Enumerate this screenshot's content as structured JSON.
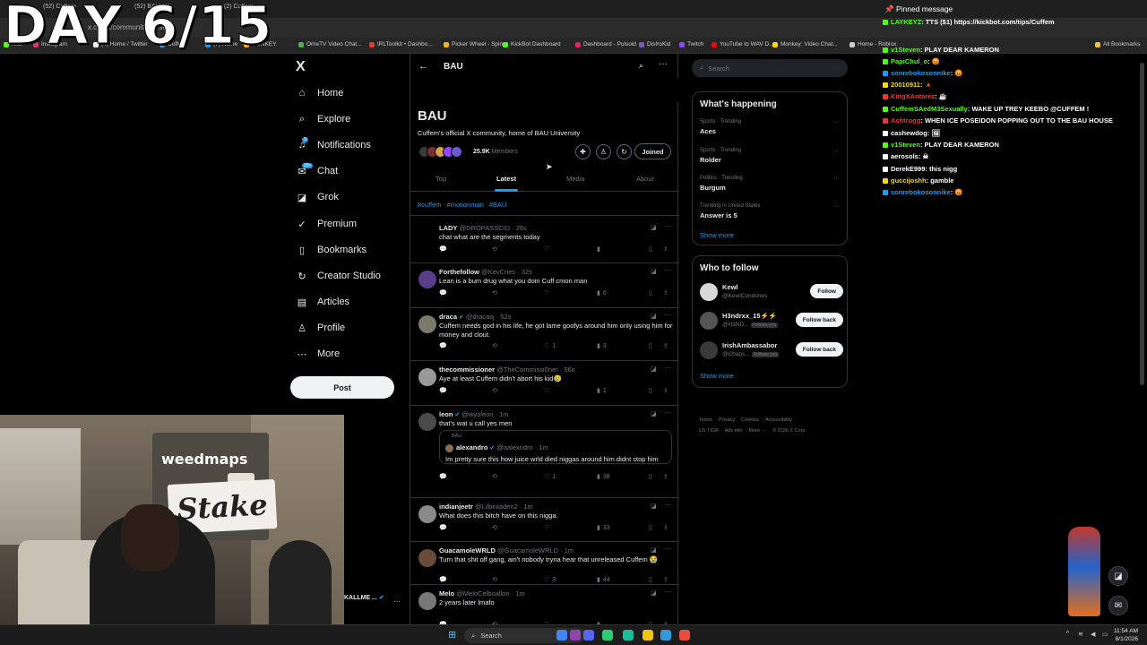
{
  "overlay": {
    "day_text": "DAY 6/15"
  },
  "browser": {
    "tabs": [
      "(52) Cuffem",
      "(52) BAU / X",
      "(2) Cuffem"
    ],
    "url": "x.com/i/communities/19086",
    "bookmarks": [
      "Kick",
      "Instagram",
      "(4) Home / Twitter",
      "Cuffem",
      "(7) Home",
      "DONKEY",
      "OmeTV Video Chat...",
      "IRLToolkit • Dashbo...",
      "Picker Wheel - Spin...",
      "KickBot Dashboard",
      "Dashboard - Pulsoid",
      "DistroKid",
      "Twitch",
      "YouTube to WAV D...",
      "Monkey: Video Chat...",
      "Home - Roblox",
      "All Bookmarks"
    ],
    "bookmark_colors": [
      "#53fc18",
      "#e1306c",
      "#ffffff",
      "#1d9bf0",
      "#1d9bf0",
      "#f5a623",
      "#4caf50",
      "#e53935",
      "#ffb300",
      "#53fc18",
      "#e91e63",
      "#7e57c2",
      "#9146ff",
      "#ff0000",
      "#ffd600",
      "#cccccc",
      "#f0c040"
    ]
  },
  "nav": {
    "logo": "X",
    "items": [
      {
        "label": "Home",
        "icon": "⌂"
      },
      {
        "label": "Explore",
        "icon": "⌕"
      },
      {
        "label": "Notifications",
        "icon": "♫",
        "badge": "3"
      },
      {
        "label": "Chat",
        "icon": "✉",
        "badge": "20+"
      },
      {
        "label": "Grok",
        "icon": "◪"
      },
      {
        "label": "Premium",
        "icon": "✓"
      },
      {
        "label": "Bookmarks",
        "icon": "▯"
      },
      {
        "label": "Creator Studio",
        "icon": "↻"
      },
      {
        "label": "Articles",
        "icon": "▤"
      },
      {
        "label": "Profile",
        "icon": "♙"
      },
      {
        "label": "More",
        "icon": "⋯"
      }
    ],
    "post_label": "Post"
  },
  "community": {
    "header_title": "BAU",
    "name": "BAU",
    "description": "Cuffem's official X community, home of BAU University",
    "member_count": "25.9K",
    "members_label": "Members",
    "joined_label": "Joined",
    "avatar_colors": [
      "#3a3a3a",
      "#7a2e2e",
      "#d4a04a",
      "#9146ff",
      "#6a5acd"
    ],
    "tabs": [
      {
        "label": "Top",
        "active": false
      },
      {
        "label": "Latest",
        "active": true
      },
      {
        "label": "Media",
        "active": false
      },
      {
        "label": "About",
        "active": false
      }
    ],
    "hashtags": [
      "#cuffem",
      "#motionman",
      "#BAU"
    ]
  },
  "tweets": [
    {
      "name": "LADY",
      "handle": "@DROPASSCID",
      "time": "26s",
      "verified": false,
      "text": "chat what are the segments today",
      "replies": "",
      "reposts": "",
      "likes": "",
      "views": "",
      "avatar": "#000000"
    },
    {
      "name": "Forthefollow",
      "handle": "@KevCries",
      "time": "32s",
      "verified": false,
      "text": "Lean is a bum drug what you doin Cuff cmon man",
      "replies": "",
      "reposts": "",
      "likes": "",
      "views": "6",
      "avatar": "#5a3e8a"
    },
    {
      "name": "draca",
      "handle": "@dracasj",
      "time": "52s",
      "verified": true,
      "text": "Cuffem needs god in his life, he got lame goofys around him only using him for money and clout.",
      "replies": "",
      "reposts": "",
      "likes": "1",
      "views": "3",
      "avatar": "#7a7a6a"
    },
    {
      "name": "thecommissioner",
      "handle": "@TheCommissi0ner",
      "time": "56s",
      "verified": false,
      "text": "Aye at least Cuffem didn't abort his kid😢",
      "replies": "",
      "reposts": "",
      "likes": "",
      "views": "1",
      "avatar": "#999999"
    },
    {
      "name": "leon",
      "handle": "@wyoleon",
      "time": "1m",
      "verified": true,
      "text": "that's wat u call yes men",
      "replies": "",
      "reposts": "",
      "likes": "1",
      "views": "38",
      "avatar": "#4a4a4a",
      "quote": {
        "community": "BAU",
        "name": "alexandro",
        "handle": "@aalexndro",
        "time": "1m",
        "verified": true,
        "text": "Im pretty sure this how juice wrld died niggas around him didnt stop him"
      }
    },
    {
      "name": "indianjeetr",
      "handle": "@Lilbinladen2",
      "time": "1m",
      "verified": false,
      "text": "What does this bitch have on this nigga.",
      "replies": "",
      "reposts": "",
      "likes": "",
      "views": "33",
      "avatar": "#8a8a8a"
    },
    {
      "name": "GuacamoleWRLD",
      "handle": "@GuacamoleWRLD",
      "time": "1m",
      "verified": false,
      "text": "Turn that shit off gang, ain't nobody tryna hear that unreleased Cuffem 😭",
      "replies": "",
      "reposts": "",
      "likes": "3",
      "views": "44",
      "avatar": "#6a4a3a"
    },
    {
      "name": "Melo",
      "handle": "@MeloCelboallon",
      "time": "1m",
      "verified": false,
      "text": "2 years later lmafo",
      "replies": "",
      "reposts": "",
      "likes": "",
      "views": "",
      "avatar": "#777777"
    }
  ],
  "right": {
    "search_placeholder": "Search",
    "happening_title": "What's happening",
    "trends": [
      {
        "meta": "Sports · Trending",
        "name": "Aces"
      },
      {
        "meta": "Sports · Trending",
        "name": "Rolder"
      },
      {
        "meta": "Politics · Trending",
        "name": "Burgum"
      },
      {
        "meta": "Trending in United States",
        "name": "Answer is 5"
      }
    ],
    "show_more": "Show more",
    "who_title": "Who to follow",
    "who": [
      {
        "name": "Kewl",
        "handle": "@KewlCondones",
        "button": "Follow",
        "follows_you": false
      },
      {
        "name": "H3ndrxx_15⚡⚡",
        "handle": "@H3ND...",
        "button": "Follow back",
        "follows_you": true
      },
      {
        "name": "IrishAmbassabor",
        "handle": "@Chaps...",
        "button": "Follow back",
        "follows_you": true
      }
    ],
    "follows_you_label": "Follows you",
    "footer": [
      "Terms",
      "Privacy",
      "Cookies",
      "Accessibility",
      "US TIDA",
      "Ads info",
      "More ···",
      "© 2026 X Corp."
    ]
  },
  "chat": {
    "pinned": "Pinned message",
    "messages": [
      {
        "user": "LAYKEYZ",
        "color": "#53fc18",
        "text": "TTS ($1) https://kickbot.com/tips/Cuffem"
      },
      {
        "user": "v1Steven",
        "color": "#53fc18",
        "text": "PLAY DEAR KAMERON"
      },
      {
        "user": "PapiChul_o",
        "color": "#53fc18",
        "text": "😡"
      },
      {
        "user": "sonrebokosonnike",
        "color": "#1d9bf0",
        "text": "😡"
      },
      {
        "user": "20010911",
        "color": "#f5d90a",
        "text": "🔺"
      },
      {
        "user": "KingXAntarez",
        "color": "#e53935",
        "text": "☕"
      },
      {
        "user": "CuffemSAedM3Sexually",
        "color": "#53fc18",
        "text": "WAKE UP TREY KEEBO @CUFFEM !"
      },
      {
        "user": "Ashtrogg",
        "color": "#e53935",
        "text": "WHEN ICE POSEIDON POPPING OUT TO THE BAU HOUSE"
      },
      {
        "user": "cashewdog",
        "color": "#ffffff",
        "text": "🖼"
      },
      {
        "user": "v1Steven",
        "color": "#53fc18",
        "text": "PLAY DEAR KAMERON"
      },
      {
        "user": "aerosols",
        "color": "#ffffff",
        "text": "☠"
      },
      {
        "user": "DerekE999",
        "color": "#ffffff",
        "text": "this nigg"
      },
      {
        "user": "guccijoshh",
        "color": "#f5d90a",
        "text": "gamble"
      },
      {
        "user": "sonrebokosonnike",
        "color": "#1d9bf0",
        "text": "😡"
      }
    ]
  },
  "webcam": {
    "weedmaps": "weedmaps",
    "stake": "Stake",
    "tab_user": "KALLME ..."
  },
  "taskbar": {
    "search": "Search",
    "time": "11:54 AM",
    "date": "8/1/2026",
    "icon_colors": [
      "#4285f4",
      "#8e44ad",
      "#5865f2",
      "#2ecc71",
      "#1abc9c",
      "#f1c40f",
      "#3498db",
      "#e74c3c"
    ]
  }
}
